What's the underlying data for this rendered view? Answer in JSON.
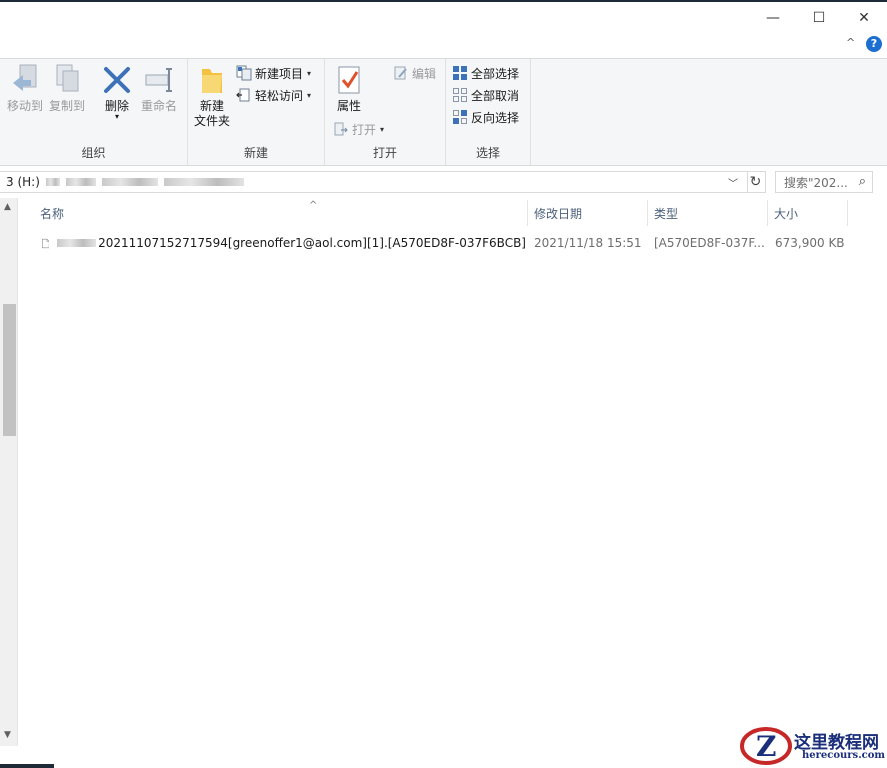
{
  "window": {
    "minimize_glyph": "—",
    "maximize_glyph": "☐",
    "close_glyph": "✕"
  },
  "ribbon": {
    "collapse_glyph": "^",
    "help_glyph": "?",
    "groups": {
      "organize": {
        "label": "组织",
        "move_to": "移动到",
        "copy_to": "复制到",
        "delete": "删除",
        "rename": "重命名"
      },
      "new": {
        "label": "新建",
        "new_folder_line1": "新建",
        "new_folder_line2": "文件夹",
        "new_item": "新建项目",
        "easy_access": "轻松访问"
      },
      "open": {
        "label": "打开",
        "properties": "属性",
        "open": "打开",
        "edit": "编辑"
      },
      "select": {
        "label": "选择",
        "select_all": "全部选择",
        "select_none": "全部取消",
        "invert_selection": "反向选择"
      }
    }
  },
  "address_bar": {
    "path_prefix": "3 (H:)",
    "search_placeholder": "搜索\"202...",
    "refresh_glyph": "↻"
  },
  "file_list": {
    "columns": [
      "名称",
      "修改日期",
      "类型",
      "大小"
    ],
    "rows": [
      {
        "name": "20211107152717594[greenoffer1@aol.com][1].[A570ED8F-037F6BCB]",
        "modified": "2021/11/18 15:51",
        "type": "[A570ED8F-037F...",
        "size": "673,900 KB"
      }
    ]
  },
  "watermark": {
    "title": "这里教程网",
    "subtitle": "herecours.com"
  },
  "colors": {
    "accent_blue": "#1c6fd1",
    "header_text": "#4c607a",
    "delete_x": "#3d72b8",
    "folder_yellow": "#f4c242",
    "checkmark_red": "#e0502b"
  }
}
